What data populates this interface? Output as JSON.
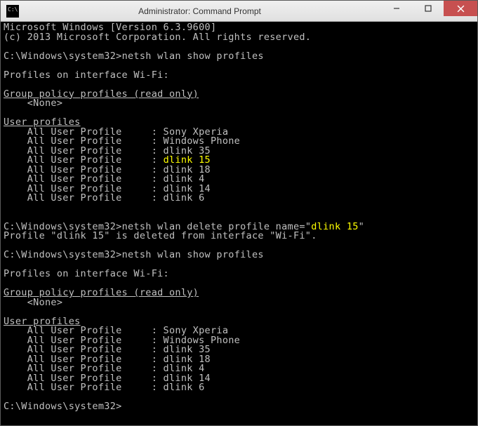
{
  "window": {
    "title": "Administrator: Command Prompt"
  },
  "intro": {
    "line1": "Microsoft Windows [Version 6.3.9600]",
    "line2": "(c) 2013 Microsoft Corporation. All rights reserved."
  },
  "prompt": "C:\\Windows\\system32>",
  "cmd1": "netsh wlan show profiles",
  "cmd2_pre": "netsh wlan delete profile name=\"",
  "cmd2_name": "dlink 15",
  "cmd2_post": "\"",
  "cmd3": "netsh wlan show profiles",
  "headers": {
    "profiles_on": "Profiles on interface Wi-Fi:",
    "group_policy": "Group policy profiles (read only)",
    "group_policy_ul": "---------------------------------",
    "none": "    <None>",
    "user_profiles": "User profiles",
    "user_profiles_ul": "-------------"
  },
  "profiles1": [
    "    All User Profile     : Sony Xperia",
    "    All User Profile     : Windows Phone",
    "    All User Profile     : dlink 35"
  ],
  "profiles1_hl_pre": "    All User Profile     : ",
  "profiles1_hl_name": "dlink 15",
  "profiles1b": [
    "    All User Profile     : dlink 18",
    "    All User Profile     : dlink 4",
    "    All User Profile     : dlink 14",
    "    All User Profile     : dlink 6"
  ],
  "delete_result": "Profile \"dlink 15\" is deleted from interface \"Wi-Fi\".",
  "profiles2": [
    "    All User Profile     : Sony Xperia",
    "    All User Profile     : Windows Phone",
    "    All User Profile     : dlink 35",
    "    All User Profile     : dlink 18",
    "    All User Profile     : dlink 4",
    "    All User Profile     : dlink 14",
    "    All User Profile     : dlink 6"
  ]
}
